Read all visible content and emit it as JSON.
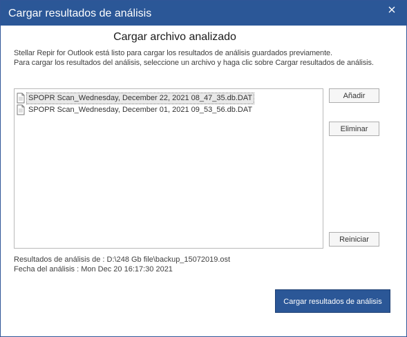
{
  "window": {
    "title": "Cargar resultados de análisis",
    "close_glyph": "✕",
    "title_bar_color": "#2b5797"
  },
  "main": {
    "heading": "Cargar archivo analizado",
    "description_line1": "Stellar Repir for Outlook está listo para cargar los resultados de análisis guardados previamente.",
    "description_line2": "Para cargar los resultados del análisis, seleccione un archivo y haga clic sobre Cargar resultados de análisis."
  },
  "file_list": {
    "items": [
      {
        "name": "SPOPR Scan_Wednesday, December 22, 2021 08_47_35.db.DAT",
        "selected": true,
        "icon": "document-icon"
      },
      {
        "name": "SPOPR Scan_Wednesday, December 01, 2021 09_53_56.db.DAT",
        "selected": false,
        "icon": "document-icon"
      }
    ]
  },
  "buttons": {
    "add_label": "Añadir",
    "remove_label": "Eliminar",
    "reset_label": "Reiniciar",
    "load_label": "Cargar resultados de análisis",
    "load_color": "#2b5797"
  },
  "info": {
    "results_of": "Resultados de análisis de : D:\\248 Gb file\\backup_15072019.ost",
    "analysis_date": "Fecha del análisis : Mon Dec 20 16:17:30 2021"
  }
}
